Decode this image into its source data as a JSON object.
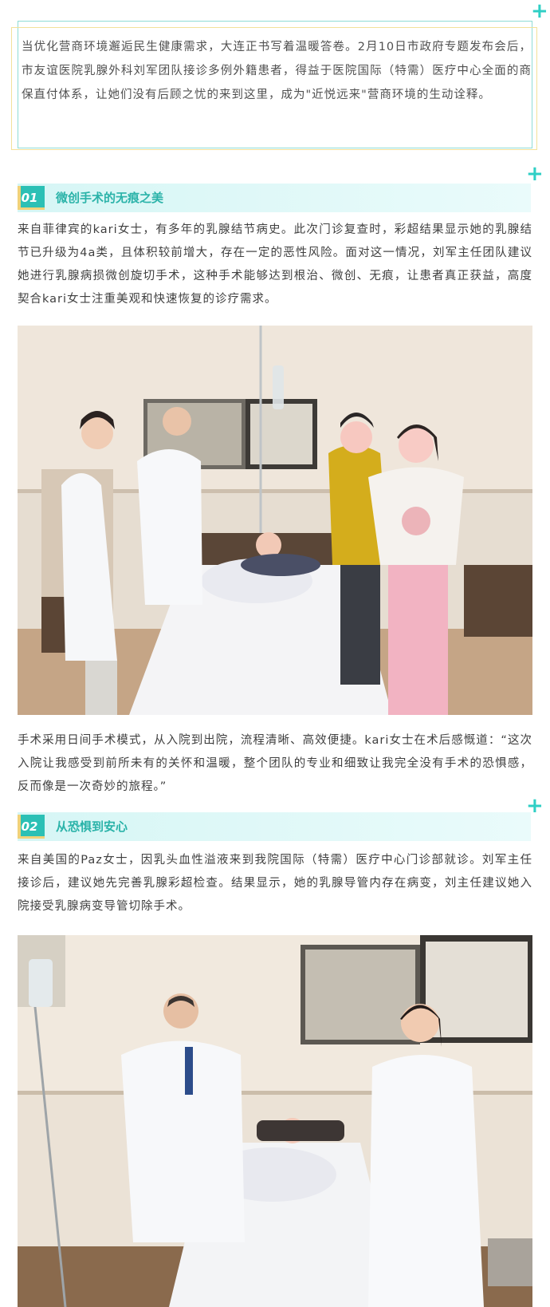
{
  "intro": {
    "text": "当优化营商环境邂逅民生健康需求，大连正书写着温暖答卷。2月10日市政府专题发布会后，市友谊医院乳腺外科刘军团队接诊多例外籍患者，得益于医院国际（特需）医疗中心全面的商保直付体系，让她们没有后顾之忧的来到这里，成为\"近悦远来\"营商环境的生动诠释。"
  },
  "sections": [
    {
      "number": "01",
      "title": "微创手术的无痕之美",
      "paragraph": "来自菲律宾的kari女士，有多年的乳腺结节病史。此次门诊复查时，彩超结果显示她的乳腺结节已升级为4a类，且体积较前增大，存在一定的恶性风险。面对这一情况，刘军主任团队建议她进行乳腺病损微创旋切手术，这种手术能够达到根治、微创、无痕，让患者真正获益，高度契合kari女士注重美观和快速恢复的诊疗需求。",
      "after_photo": "手术采用日间手术模式，从入院到出院，流程清晰、高效便捷。kari女士在术后感慨道：“这次入院让我感受到前所未有的关怀和温暖，整个团队的专业和细致让我完全没有手术的恐惧感，反而像是一次奇妙的旅程。”"
    },
    {
      "number": "02",
      "title": "从恐惧到安心",
      "paragraph": "来自美国的Paz女士，因乳头血性溢液来到我院国际（特需）医疗中心门诊部就诊。刘军主任接诊后，建议她先完善乳腺彩超检查。结果显示，她的乳腺导管内存在病变，刘主任建议她入院接受乳腺病变导管切除手术。"
    }
  ],
  "colors": {
    "accent": "#2bc0b5",
    "accent_light": "#d6f6f5",
    "gold": "#f0d27a",
    "text": "#3f3f3f"
  }
}
